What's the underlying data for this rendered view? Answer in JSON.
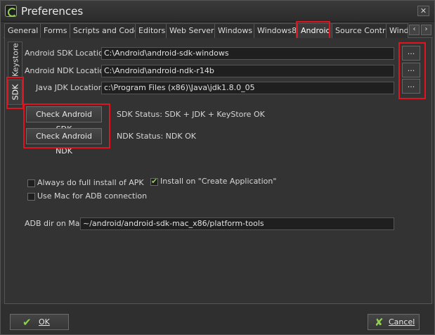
{
  "window": {
    "title": "Preferences",
    "close_label": "✕"
  },
  "tabs": [
    {
      "label": "General"
    },
    {
      "label": "Forms"
    },
    {
      "label": "Scripts and Code"
    },
    {
      "label": "Editors"
    },
    {
      "label": "Web Server"
    },
    {
      "label": "Windows"
    },
    {
      "label": "Windows8"
    },
    {
      "label": "Android"
    },
    {
      "label": "Source Control"
    },
    {
      "label": "Wind"
    }
  ],
  "tab_arrows": {
    "left": "‹",
    "right": "›"
  },
  "side_tabs": {
    "keystore": "Keystore",
    "sdk": "SDK"
  },
  "sdk": {
    "android_sdk_label": "Android SDK Location",
    "android_sdk_value": "C:\\Android\\android-sdk-windows",
    "android_ndk_label": "Android NDK Location",
    "android_ndk_value": "C:\\Android\\android-ndk-r14b",
    "java_jdk_label": "Java JDK Location",
    "java_jdk_value": "c:\\Program Files (x86)\\Java\\jdk1.8.0_05",
    "browse_label": "...",
    "check_sdk_button": "Check Android SDK",
    "check_ndk_button": "Check Android NDK",
    "sdk_status": "SDK Status:  SDK + JDK + KeyStore OK",
    "ndk_status": "NDK Status:  NDK OK"
  },
  "options": {
    "always_full_install": "Always do full install of APK",
    "install_on_create": "Install on \"Create Application\"",
    "use_mac_adb": "Use Mac for ADB connection",
    "always_full_install_checked": false,
    "install_on_create_checked": true,
    "use_mac_adb_checked": false
  },
  "adb": {
    "label": "ADB dir on Mac",
    "value": "~/android/android-sdk-mac_x86/platform-tools"
  },
  "footer": {
    "ok_label": "OK",
    "cancel_label": "Cancel"
  },
  "colors": {
    "highlight": "#e0141e",
    "accent": "#8fd14f",
    "background": "#333333"
  }
}
